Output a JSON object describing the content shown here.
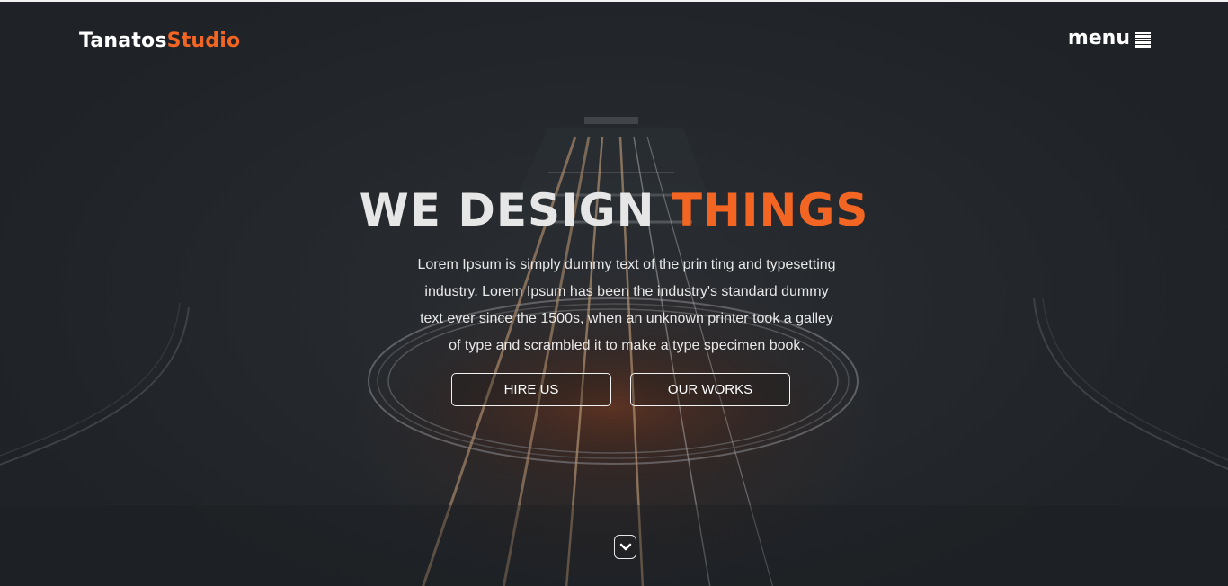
{
  "brand": {
    "name_white": "Tanatos",
    "name_orange": "Studio"
  },
  "nav": {
    "menu_label": "menu",
    "menu_icon": "hamburger-icon"
  },
  "hero": {
    "headline_white": "WE DESIGN",
    "headline_orange": "THINGS",
    "lead_lines": [
      "Lorem Ipsum is simply dummy text of the prin ting and typesetting",
      "industry. Lorem Ipsum has been the industry's standard dummy",
      "text ever since the 1500s, when an unknown printer took a galley",
      "of type and scrambled it to make a type specimen book."
    ],
    "buttons": {
      "hire": "HIRE US",
      "works": "OUR WORKS"
    },
    "scroll_icon": "chevron-down-icon"
  },
  "colors": {
    "accent": "#f26522",
    "background": "#23272b",
    "text": "#ffffff"
  }
}
